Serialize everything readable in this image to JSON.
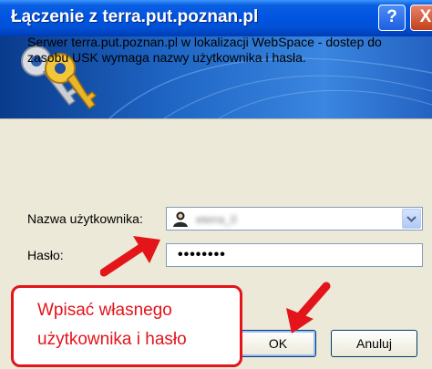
{
  "window": {
    "title": "Łączenie z terra.put.poznan.pl",
    "help_label": "?",
    "close_label": "X"
  },
  "dialog": {
    "message": "Serwer terra.put.poznan.pl w lokalizacji WebSpace - dostep do zasobu USK wymaga nazwy użytkownika i hasła.",
    "username_label": "Nazwa użytkownika:",
    "username_value": "eterra_0",
    "password_label": "Hasło:",
    "password_value": "••••••••",
    "ok_label": "OK",
    "cancel_label": "Anuluj"
  },
  "annotation": {
    "line1": "Wpisać własnego",
    "line2": "użytkownika i hasło",
    "color": "#e3141a"
  },
  "icons": [
    "keys-icon",
    "user-icon",
    "chevron-down-icon",
    "arrow-icon"
  ]
}
